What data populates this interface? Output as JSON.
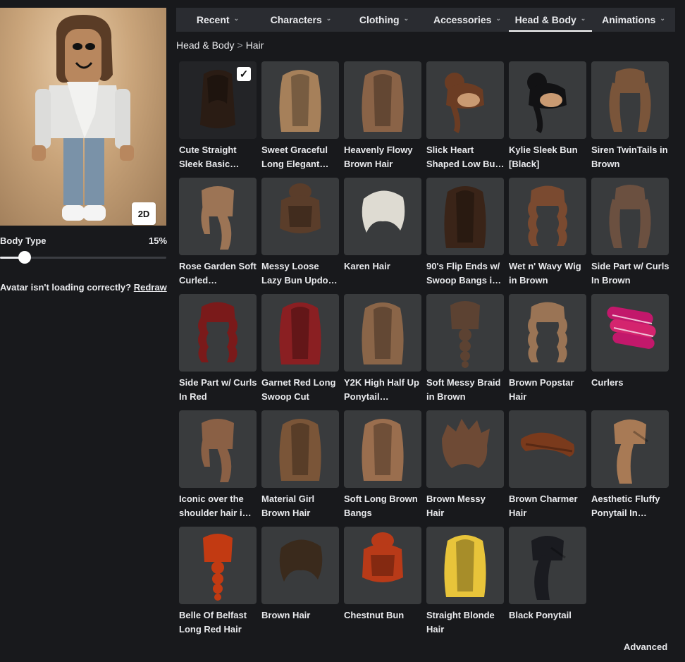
{
  "nav": {
    "tabs": [
      {
        "label": "Recent",
        "active": false
      },
      {
        "label": "Characters",
        "active": false
      },
      {
        "label": "Clothing",
        "active": false
      },
      {
        "label": "Accessories",
        "active": false
      },
      {
        "label": "Head & Body",
        "active": true
      },
      {
        "label": "Animations",
        "active": false
      }
    ]
  },
  "breadcrumb": {
    "parent": "Head & Body",
    "separator": ">",
    "current": "Hair"
  },
  "avatar": {
    "view_toggle_label": "2D",
    "body_type_label": "Body Type",
    "body_type_value": "15%",
    "body_type_fraction": 0.15,
    "issue_text": "Avatar isn't loading correctly?",
    "redraw_label": "Redraw"
  },
  "items": [
    {
      "name": "Cute Straight Sleek Basic…",
      "color": "#2a1c14",
      "style": "straight",
      "selected": true
    },
    {
      "name": "Sweet Graceful Long Elegant…",
      "color": "#a6805a",
      "style": "long"
    },
    {
      "name": "Heavenly Flowy Brown Hair",
      "color": "#8a6347",
      "style": "long"
    },
    {
      "name": "Slick Heart Shaped Low Bu…",
      "color": "#6b3c23",
      "style": "bun"
    },
    {
      "name": "Kylie Sleek Bun [Black]",
      "color": "#121214",
      "style": "bun"
    },
    {
      "name": "Siren TwinTails in Brown",
      "color": "#7a553a",
      "style": "twin"
    },
    {
      "name": "Rose Garden Soft Curled…",
      "color": "#9c7455",
      "style": "side"
    },
    {
      "name": "Messy Loose Lazy Bun Updo…",
      "color": "#5a3d2a",
      "style": "updo"
    },
    {
      "name": "Karen Hair",
      "color": "#dedbd2",
      "style": "short"
    },
    {
      "name": "90's Flip Ends w/ Swoop Bangs i…",
      "color": "#3a2418",
      "style": "long"
    },
    {
      "name": "Wet n' Wavy Wig in Brown",
      "color": "#7a4a30",
      "style": "wavy"
    },
    {
      "name": "Side Part w/ Curls In Brown",
      "color": "#6b5040",
      "style": "twin"
    },
    {
      "name": "Side Part w/ Curls In Red",
      "color": "#7a1a1a",
      "style": "wavy"
    },
    {
      "name": "Garnet Red Long Swoop Cut",
      "color": "#8a1f22",
      "style": "long"
    },
    {
      "name": "Y2K High Half Up Ponytail…",
      "color": "#8a6548",
      "style": "long"
    },
    {
      "name": "Soft Messy Braid in Brown",
      "color": "#5c4232",
      "style": "braid"
    },
    {
      "name": "Brown Popstar Hair",
      "color": "#9a7455",
      "style": "wavy"
    },
    {
      "name": "Curlers",
      "color": "#c2186b",
      "style": "curlers"
    },
    {
      "name": "Iconic over the shoulder hair i…",
      "color": "#8a6045",
      "style": "side"
    },
    {
      "name": "Material Girl Brown Hair",
      "color": "#7a5538",
      "style": "long"
    },
    {
      "name": "Soft Long Brown Bangs",
      "color": "#9a6e4e",
      "style": "long"
    },
    {
      "name": "Brown Messy Hair",
      "color": "#6e4a35",
      "style": "messy"
    },
    {
      "name": "Brown Charmer Hair",
      "color": "#7a3a1c",
      "style": "swoop"
    },
    {
      "name": "Aesthetic Fluffy Ponytail In…",
      "color": "#a87a55",
      "style": "ponytail"
    },
    {
      "name": "Belle Of Belfast Long Red Hair",
      "color": "#c23a12",
      "style": "braid"
    },
    {
      "name": "Brown Hair",
      "color": "#3a2a1c",
      "style": "short"
    },
    {
      "name": "Chestnut Bun",
      "color": "#b83a18",
      "style": "updo"
    },
    {
      "name": "Straight Blonde Hair",
      "color": "#e8c43a",
      "style": "long"
    },
    {
      "name": "Black Ponytail",
      "color": "#1a1b20",
      "style": "ponytail"
    }
  ],
  "advanced_label": "Advanced"
}
